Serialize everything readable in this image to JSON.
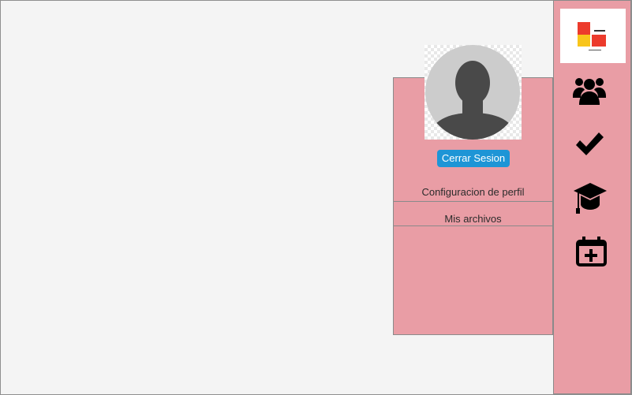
{
  "colors": {
    "background": "#f4f4f4",
    "panel": "#e99da5",
    "sidebar": "#e99da5",
    "button": "#1e95d6",
    "logo_red": "#ec3b2c",
    "logo_yellow": "#f8c51b"
  },
  "profile_menu": {
    "avatar": "default-user-avatar",
    "logout_label": "Cerrar Sesion",
    "items": [
      {
        "label": "Configuracion de perfil"
      },
      {
        "label": "Mis archivos"
      }
    ]
  },
  "sidebar": {
    "logo": "app-logo",
    "items": [
      {
        "icon": "users-icon"
      },
      {
        "icon": "checkmark-icon"
      },
      {
        "icon": "graduation-cap-icon"
      },
      {
        "icon": "calendar-add-icon"
      }
    ]
  }
}
